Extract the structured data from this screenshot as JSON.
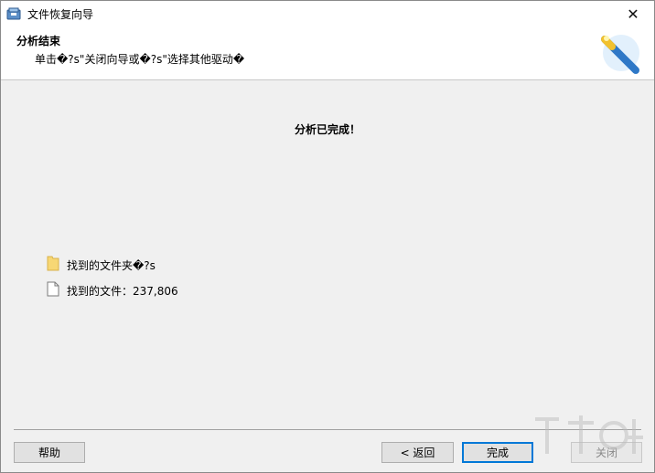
{
  "window": {
    "title": "文件恢复向导",
    "close_glyph": "✕"
  },
  "header": {
    "title": "分析结束",
    "subtitle": "单击�?s\"关闭向导或�?s\"选择其他驱动�"
  },
  "main": {
    "status": "分析已完成！",
    "results": [
      {
        "icon": "folder-icon",
        "label": "找到的文件夹�?s"
      },
      {
        "icon": "file-icon",
        "label": "找到的文件：237,806"
      }
    ]
  },
  "buttons": {
    "help": "帮助",
    "back": "< 返回",
    "finish": "完成",
    "close": "关闭"
  },
  "colors": {
    "accent": "#0078d7",
    "folder": "#f7d774",
    "window_bg": "#f0f0f0"
  }
}
